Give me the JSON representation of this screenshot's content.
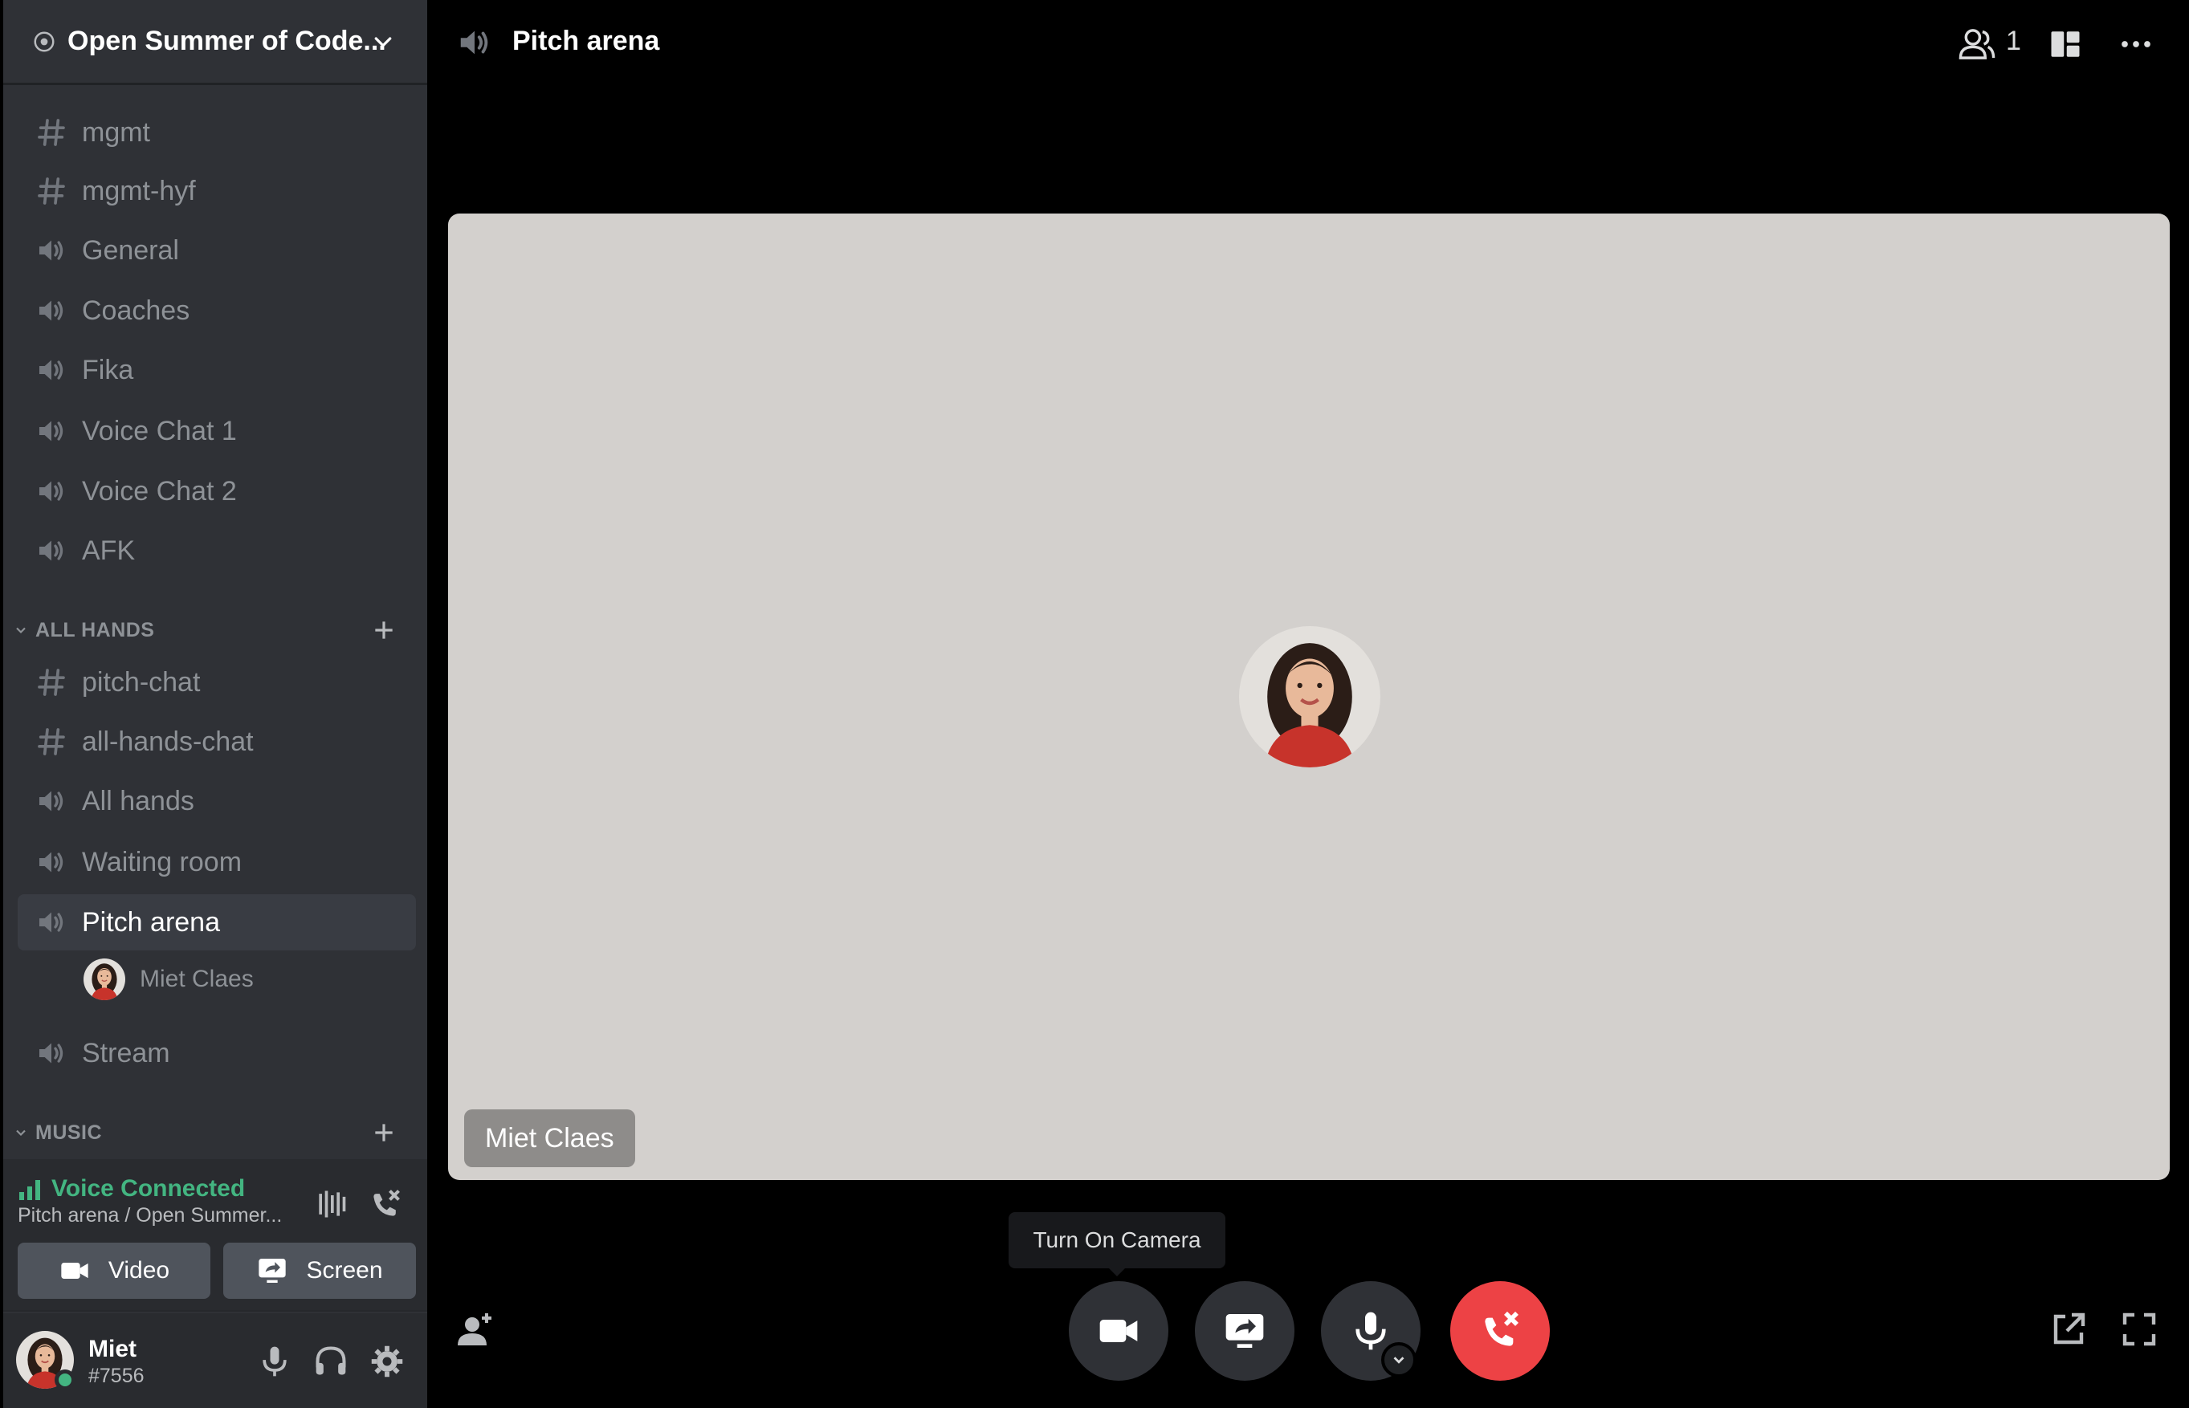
{
  "sidebar": {
    "server_name": "Open Summer of Code...",
    "channels_top": [
      {
        "label": "mgmt",
        "icon": "text-channel-icon"
      },
      {
        "label": "mgmt-hyf",
        "icon": "text-channel-icon"
      },
      {
        "label": "General",
        "icon": "voice-channel-icon"
      },
      {
        "label": "Coaches",
        "icon": "voice-channel-icon"
      },
      {
        "label": "Fika",
        "icon": "voice-channel-icon"
      },
      {
        "label": "Voice Chat 1",
        "icon": "voice-channel-icon"
      },
      {
        "label": "Voice Chat 2",
        "icon": "voice-channel-icon"
      },
      {
        "label": "AFK",
        "icon": "voice-channel-icon"
      }
    ],
    "category_all_hands": "ALL HANDS",
    "channels_all_hands": [
      {
        "label": "pitch-chat",
        "icon": "text-channel-icon"
      },
      {
        "label": "all-hands-chat",
        "icon": "text-channel-icon"
      },
      {
        "label": "All hands",
        "icon": "voice-channel-icon"
      },
      {
        "label": "Waiting room",
        "icon": "voice-channel-icon"
      },
      {
        "label": "Pitch arena",
        "icon": "voice-channel-icon",
        "active": true
      }
    ],
    "voice_member": "Miet Claes",
    "stream_channel": "Stream",
    "category_music": "MUSIC"
  },
  "voice_panel": {
    "status": "Voice Connected",
    "location": "Pitch arena / Open Summer...",
    "video_label": "Video",
    "screen_label": "Screen",
    "status_color": "#43b581"
  },
  "user_panel": {
    "name": "Miet",
    "tag": "#7556"
  },
  "main": {
    "channel_title": "Pitch arena",
    "member_count": "1",
    "participant_name": "Miet Claes",
    "tooltip": "Turn On Camera",
    "disconnect_color": "#ed4245"
  }
}
